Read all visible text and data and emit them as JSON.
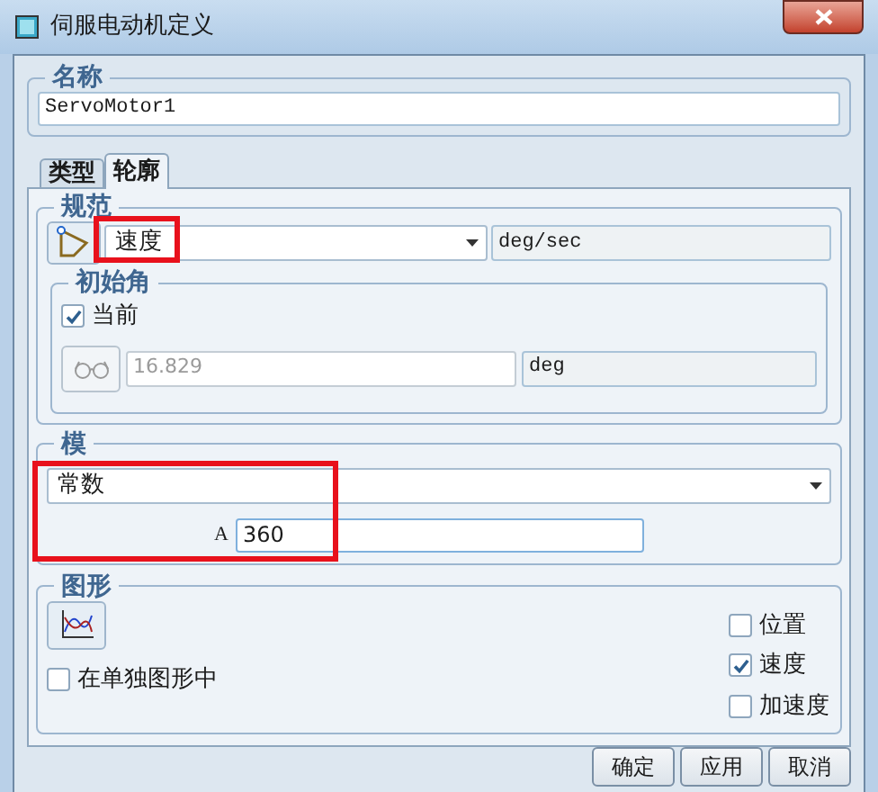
{
  "window": {
    "title": "伺服电动机定义"
  },
  "name_group": {
    "label": "名称",
    "value": "ServoMotor1"
  },
  "tabs": [
    {
      "label": "类型",
      "selected": false
    },
    {
      "label": "轮廓",
      "selected": true
    }
  ],
  "spec_group": {
    "label": "规范",
    "dropdown": "速度",
    "unit": "deg/sec",
    "highlighted": true
  },
  "initial_angle": {
    "label": "初始角",
    "checkbox": {
      "label": "当前",
      "checked": true
    },
    "value": "16.829",
    "unit": "deg",
    "disabled": true
  },
  "magnitude": {
    "label": "模",
    "dropdown": "常数",
    "param_label": "A",
    "param_value": "360",
    "highlighted": true
  },
  "graph": {
    "label": "图形",
    "separate": {
      "label": "在单独图形中",
      "checked": false
    },
    "options": [
      {
        "label": "位置",
        "checked": false
      },
      {
        "label": "速度",
        "checked": true
      },
      {
        "label": "加速度",
        "checked": false
      }
    ]
  },
  "buttons": [
    {
      "label": "确定"
    },
    {
      "label": "应用"
    },
    {
      "label": "取消"
    }
  ]
}
